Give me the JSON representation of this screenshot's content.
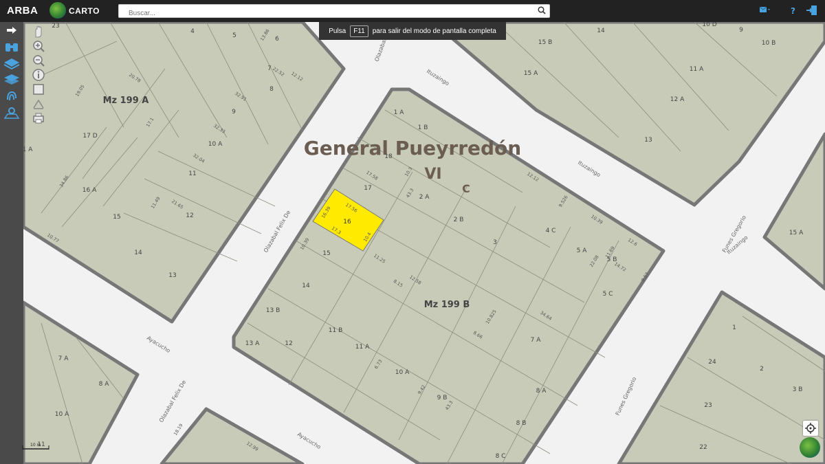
{
  "header": {
    "brand": "ARBA",
    "carto": "CARTO",
    "search_placeholder": "Buscar..."
  },
  "fullscreen_tip": {
    "prefix": "Pulsa",
    "key": "F11",
    "suffix": "para salir del modo de pantalla completa"
  },
  "left_toolbar": {
    "icons": [
      "arrow-right-icon",
      "binoculars-icon",
      "layers-icon",
      "layers-stack-icon",
      "fingerprint-icon",
      "map-pin-icon"
    ]
  },
  "map_tools": {
    "icons": [
      "hand-pan-icon",
      "zoom-in-icon",
      "zoom-out-icon",
      "info-icon",
      "square-select-icon",
      "measure-icon",
      "print-icon"
    ]
  },
  "map": {
    "municipality": "General Pueyrredón",
    "circ": "VI",
    "section": "C",
    "block_labels": [
      "Mz 199 A",
      "Mz 199 B"
    ],
    "streets": [
      "Olazabal Felix De",
      "Olazabal Felix De",
      "Olazabal Felix De",
      "Ituzaingo",
      "Ituzaingo",
      "Ituzaingo",
      "Ayacucho",
      "Ayacucho",
      "Funes Gregorio",
      "Funes Gregorio"
    ],
    "selected_parcel": "16",
    "parcels_mz199a": [
      "4",
      "5",
      "6",
      "7",
      "8",
      "9",
      "10 A",
      "11",
      "12",
      "13",
      "14",
      "15",
      "16 A",
      "17 D",
      "23",
      "1 A"
    ],
    "parcels_mz199b": [
      "1 A",
      "1 B",
      "2 A",
      "2 B",
      "3",
      "4 C",
      "5 A",
      "5 B",
      "5 C",
      "7 A",
      "8 A",
      "8 B",
      "8 C",
      "9 B",
      "10 A",
      "11 A",
      "11 B",
      "12",
      "13 A",
      "13 B",
      "14",
      "15",
      "17",
      "18"
    ],
    "parcels_other": [
      "14",
      "15 A",
      "15 B",
      "13",
      "12 A",
      "11 A",
      "10 B",
      "10 D",
      "9",
      "1",
      "2",
      "3 B",
      "24",
      "23",
      "22",
      "15 A",
      "7 A",
      "8 A",
      "10 A",
      "11"
    ],
    "dimensions": [
      "10.39",
      "17.56",
      "17.3",
      "16.39",
      "10.4",
      "17.58",
      "10.3",
      "43.3",
      "11.25",
      "12.58",
      "8.15",
      "10.825",
      "34.64",
      "9.526",
      "12.12",
      "10.39",
      "14.72",
      "12.6",
      "22.08",
      "11.69",
      "9.57",
      "6.73",
      "43.3",
      "9.42",
      "8.66",
      "20.78",
      "32.91",
      "34.86",
      "22.52",
      "13.86",
      "12.12",
      "19.05",
      "17.1",
      "11.49",
      "21.65",
      "32.04",
      "32.33",
      "10.77",
      "18.19",
      "12.99"
    ],
    "scale": "10 m"
  },
  "colors": {
    "topbar": "#222222",
    "parcel_fill": "#c8cbb8",
    "block_outline": "#777777",
    "selected": "#ffea00",
    "street": "#f2f2f2",
    "accent": "#4aa3df"
  }
}
